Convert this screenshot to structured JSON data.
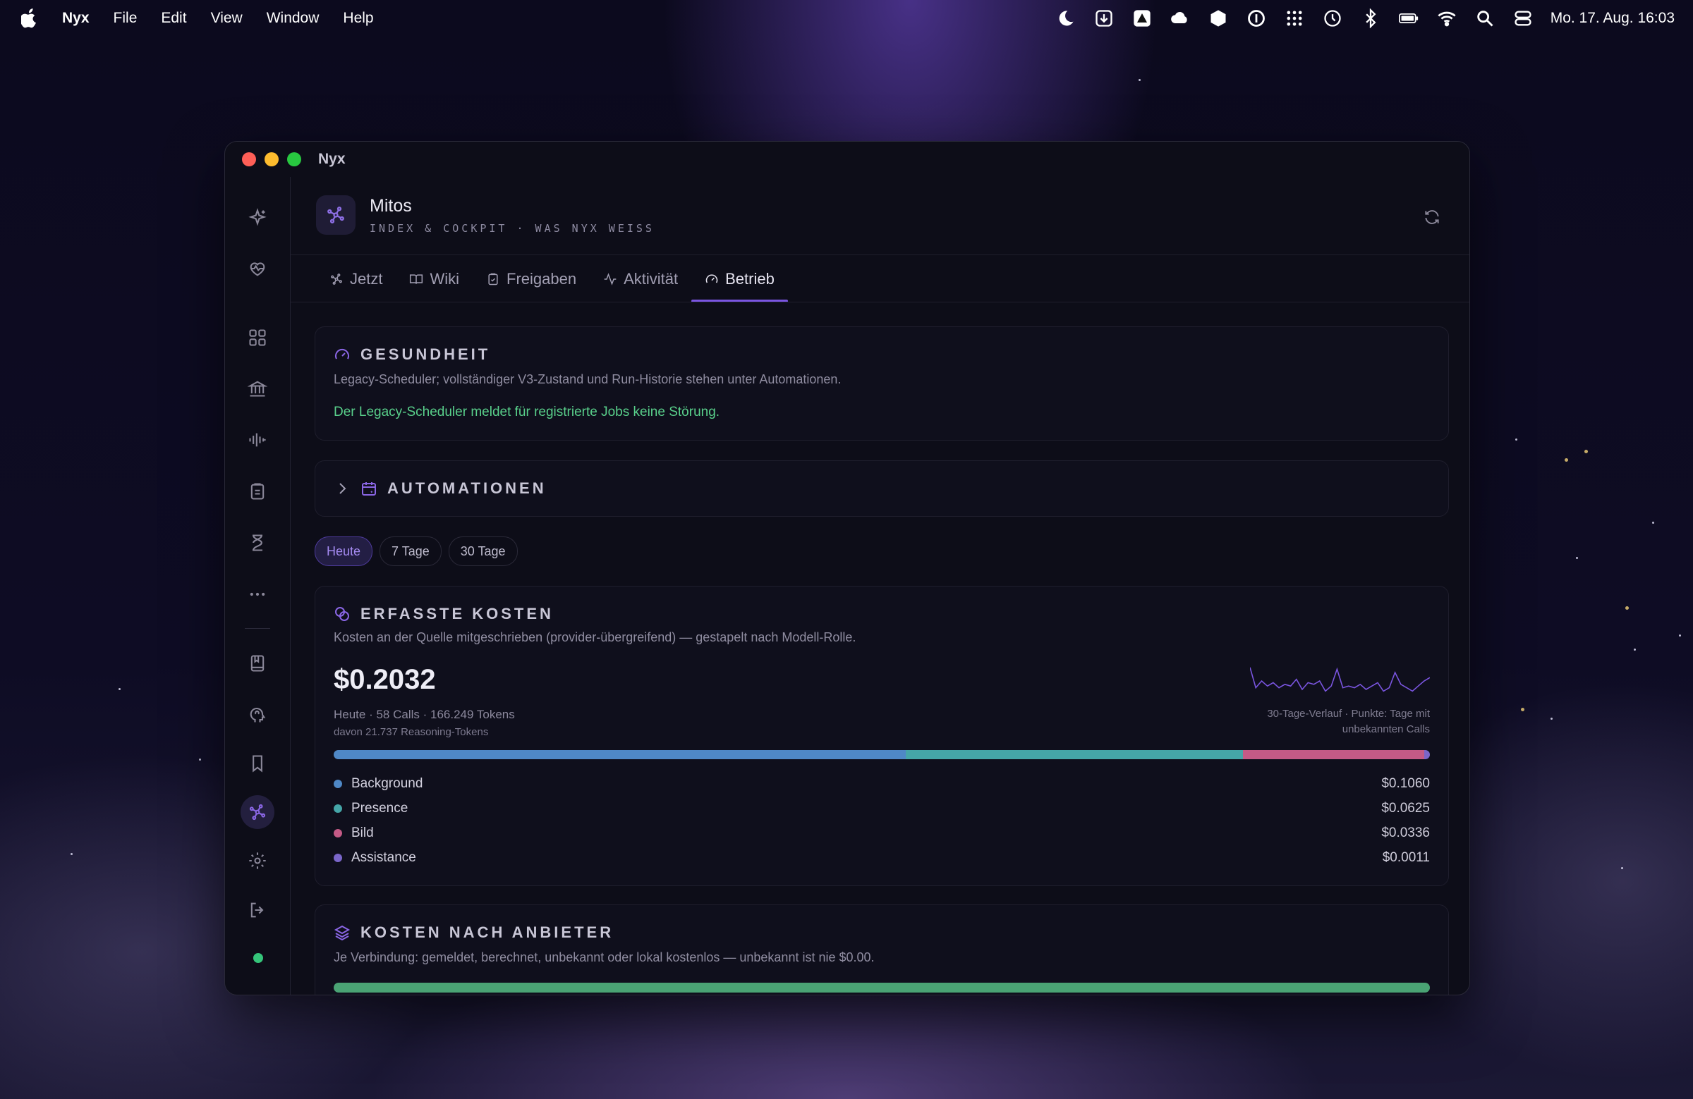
{
  "menubar": {
    "app": "Nyx",
    "menus": [
      "File",
      "Edit",
      "View",
      "Window",
      "Help"
    ],
    "datetime": "Mo. 17. Aug.  16:03"
  },
  "window": {
    "title": "Nyx",
    "header": {
      "title": "Mitos",
      "subtitle": "INDEX & COCKPIT · WAS NYX WEISS"
    },
    "tabs": [
      {
        "label": "Jetzt",
        "icon": "mitos-icon"
      },
      {
        "label": "Wiki",
        "icon": "book-icon"
      },
      {
        "label": "Freigaben",
        "icon": "clipboard-icon"
      },
      {
        "label": "Aktivität",
        "icon": "activity-icon"
      },
      {
        "label": "Betrieb",
        "icon": "gauge-icon",
        "active": true
      }
    ],
    "health": {
      "title": "GESUNDHEIT",
      "description": "Legacy-Scheduler; vollständiger V3-Zustand und Run-Historie stehen unter Automationen.",
      "status": "Der Legacy-Scheduler meldet für registrierte Jobs keine Störung."
    },
    "automations": {
      "title": "AUTOMATIONEN"
    },
    "filters": [
      "Heute",
      "7 Tage",
      "30 Tage"
    ],
    "active_filter": "Heute",
    "costs": {
      "title": "ERFASSTE KOSTEN",
      "description": "Kosten an der Quelle mitgeschrieben (provider-übergreifend) — gestapelt nach Modell-Rolle.",
      "total": "$0.2032",
      "meta": "Heute · 58 Calls · 166.249 Tokens",
      "reasoning": "davon 21.737 Reasoning-Tokens",
      "spark_caption_1": "30-Tage-Verlauf · Punkte: Tage mit",
      "spark_caption_2": "unbekannten Calls",
      "breakdown": [
        {
          "name": "Background",
          "amount": "$0.1060",
          "value": 0.106,
          "color": "#4f88c6"
        },
        {
          "name": "Presence",
          "amount": "$0.0625",
          "value": 0.0625,
          "color": "#45a6a8"
        },
        {
          "name": "Bild",
          "amount": "$0.0336",
          "value": 0.0336,
          "color": "#c45a86"
        },
        {
          "name": "Assistance",
          "amount": "$0.0011",
          "value": 0.0011,
          "color": "#7a66c9"
        }
      ],
      "sparkline": [
        0.9,
        0.3,
        0.5,
        0.35,
        0.45,
        0.3,
        0.4,
        0.35,
        0.55,
        0.25,
        0.45,
        0.4,
        0.5,
        0.2,
        0.35,
        0.85,
        0.3,
        0.35,
        0.3,
        0.4,
        0.25,
        0.35,
        0.45,
        0.2,
        0.3,
        0.75,
        0.4,
        0.3,
        0.2,
        0.35,
        0.5,
        0.6
      ]
    },
    "providers": {
      "title": "KOSTEN NACH ANBIETER",
      "description": "Je Verbindung: gemeldet, berechnet, unbekannt oder lokal kostenlos — unbekannt ist nie $0.00."
    }
  },
  "colors": {
    "accent": "#7a55e0",
    "ok": "#59d08b"
  }
}
